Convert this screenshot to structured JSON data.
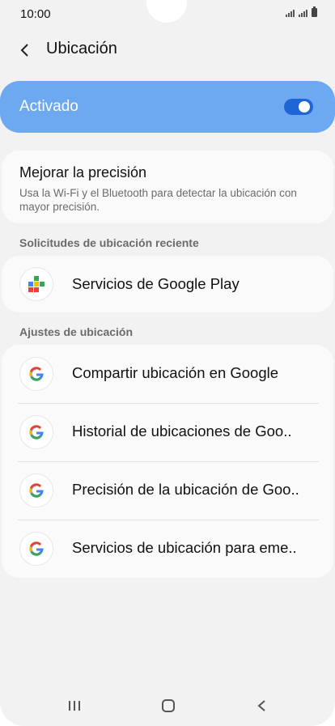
{
  "status_bar": {
    "time": "10:00"
  },
  "header": {
    "title": "Ubicación"
  },
  "master_switch": {
    "label": "Activado",
    "state": "on",
    "accent_color": "#6ca9f0"
  },
  "precision": {
    "title": "Mejorar la precisión",
    "subtitle": "Usa la Wi-Fi y el Bluetooth para detectar la ubicación con mayor precisión."
  },
  "recent_requests": {
    "header": "Solicitudes de ubicación reciente",
    "items": [
      {
        "label": "Servicios de Google Play",
        "icon": "google-play-services-icon"
      }
    ]
  },
  "location_settings": {
    "header": "Ajustes de ubicación",
    "items": [
      {
        "label": "Compartir ubicación en Google",
        "icon": "google-icon"
      },
      {
        "label": "Historial de ubicaciones de Goo..",
        "icon": "google-icon"
      },
      {
        "label": "Precisión de la ubicación de Goo..",
        "icon": "google-icon"
      },
      {
        "label": "Servicios de ubicación para eme..",
        "icon": "google-icon"
      }
    ]
  },
  "nav_bar": {
    "icons": [
      "recents-icon",
      "home-icon",
      "back-icon"
    ]
  }
}
